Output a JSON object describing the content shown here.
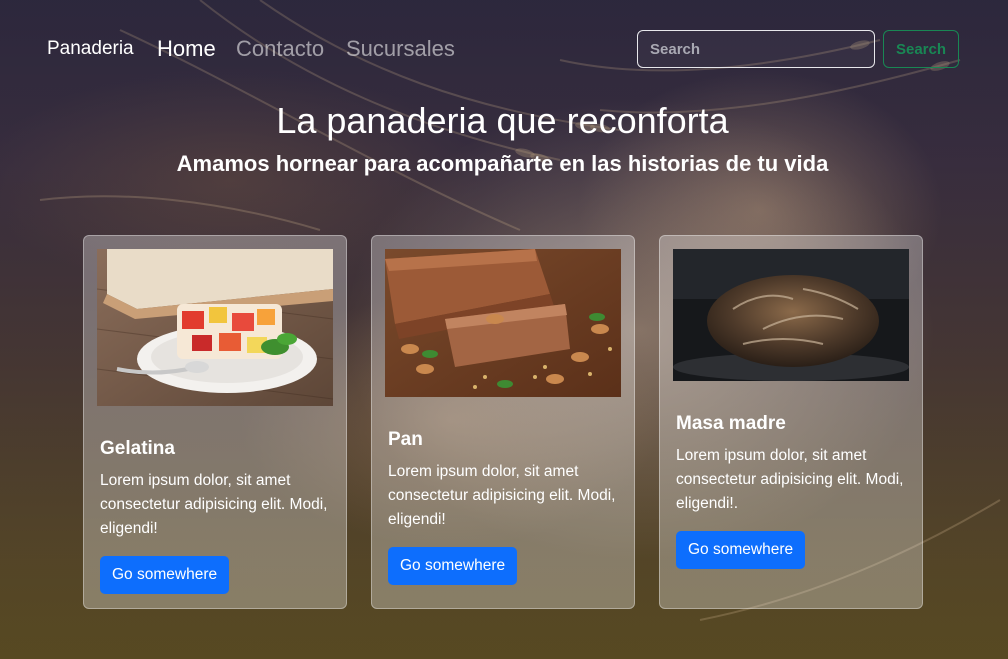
{
  "navbar": {
    "brand": "Panaderia",
    "links": [
      {
        "label": "Home",
        "active": true
      },
      {
        "label": "Contacto",
        "active": false
      },
      {
        "label": "Sucursales",
        "active": false
      }
    ],
    "search": {
      "placeholder": "Search",
      "value": "",
      "button_label": "Search"
    }
  },
  "hero": {
    "title": "La panaderia que reconforta",
    "subtitle": "Amamos hornear para acompañarte en las historias de tu vida"
  },
  "cards": [
    {
      "image": "gelatina-photo",
      "title": "Gelatina",
      "text": "Lorem ipsum dolor, sit amet consectetur adipisicing elit. Modi, eligendi!",
      "button_label": "Go somewhere"
    },
    {
      "image": "pan-photo",
      "title": "Pan",
      "text": "Lorem ipsum dolor, sit amet consectetur adipisicing elit. Modi, eligendi!",
      "button_label": "Go somewhere"
    },
    {
      "image": "masa-madre-photo",
      "title": "Masa madre",
      "text": "Lorem ipsum dolor, sit amet consectetur adipisicing elit. Modi, eligendi!.",
      "button_label": "Go somewhere"
    }
  ],
  "colors": {
    "primary_button": "#0d6efd",
    "search_button": "#198754",
    "text": "#ffffff"
  }
}
